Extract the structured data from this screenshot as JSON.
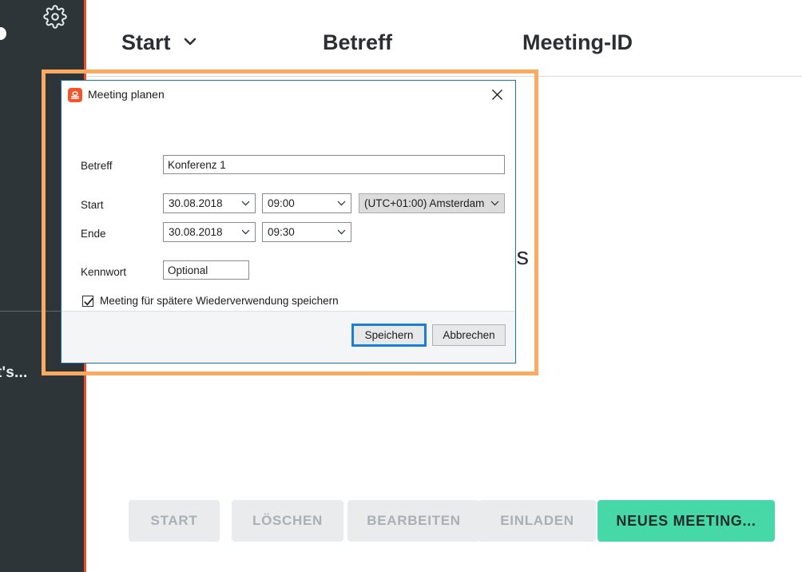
{
  "sidebar": {
    "gear_icon": "gear-icon",
    "avatar_icon": "avatar-dot",
    "chat_label": "t's..."
  },
  "main": {
    "columns": [
      {
        "label": "Start",
        "sort_icon": "chevron-down-icon"
      },
      {
        "label": "Betreff",
        "sort_icon": ""
      },
      {
        "label": "Meeting-ID",
        "sort_icon": ""
      }
    ],
    "empty_state": "anten Meetings",
    "action_buttons": [
      {
        "label": "START",
        "state": "disabled"
      },
      {
        "label": "LÖSCHEN",
        "state": "disabled"
      },
      {
        "label": "BEARBEITEN",
        "state": "disabled"
      },
      {
        "label": "EINLADEN",
        "state": "disabled"
      },
      {
        "label": "NEUES MEETING...",
        "state": "primary"
      }
    ]
  },
  "dialog": {
    "title": "Meeting planen",
    "app_icon": "zoom-app-icon",
    "close_icon": "close-icon",
    "fields": {
      "betreff": {
        "label": "Betreff",
        "value": "Konferenz 1"
      },
      "start": {
        "label": "Start",
        "date": "30.08.2018",
        "time": "09:00",
        "timezone": "(UTC+01:00) Amsterdam"
      },
      "ende": {
        "label": "Ende",
        "date": "30.08.2018",
        "time": "09:30"
      },
      "kennwort": {
        "label": "Kennwort",
        "value": "Optional"
      }
    },
    "checkbox": {
      "label": "Meeting für spätere Wiederverwendung speichern",
      "checked": true
    },
    "footer": {
      "save_label": "Speichern",
      "cancel_label": "Abbrechen"
    }
  },
  "annotation": {
    "color": "#fbab61",
    "shape": "rectangle-highlight"
  },
  "colors": {
    "sidebar_bg": "#2e3539",
    "sidebar_accent": "#e8502a",
    "primary_button": "#46d8a6",
    "disabled_button_bg": "#eaebec",
    "disabled_button_text": "#a9b0b5",
    "dialog_border": "#1a72b8",
    "focus_border": "#1a7fd4",
    "annotation": "#fbab61"
  }
}
